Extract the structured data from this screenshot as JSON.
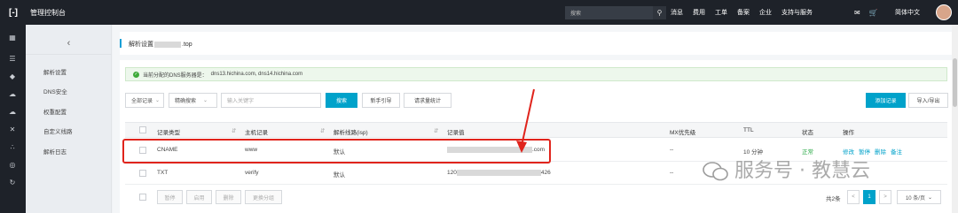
{
  "topbar": {
    "logo": "[-]",
    "title": "管理控制台",
    "search_placeholder": "搜索",
    "nav": [
      "消息",
      "费用",
      "工单",
      "备案",
      "企业",
      "支持与服务"
    ],
    "lang": "简体中文"
  },
  "subsidebar": {
    "back": "‹",
    "items": [
      "解析设置",
      "DNS安全",
      "权重配置",
      "自定义线路",
      "解析日志"
    ]
  },
  "page": {
    "title_prefix": "解析设置",
    "title_suffix": ".top"
  },
  "dns_info": {
    "label": "当前分配的DNS服务器是：",
    "servers": "dns13.hichina.com, dns14.hichina.com"
  },
  "toolbar": {
    "filter_all": "全部记录",
    "filter_mode": "精确搜索",
    "keyword_placeholder": "输入关键字",
    "search": "搜索",
    "guide": "新手引导",
    "stats": "请求量统计",
    "add": "添加记录",
    "import_export": "导入/导出"
  },
  "table": {
    "headers": [
      "记录类型",
      "主机记录",
      "解析线路(isp)",
      "记录值",
      "MX优先级",
      "TTL",
      "状态",
      "操作"
    ],
    "rows": [
      {
        "type": "CNAME",
        "host": "www",
        "line": "默认",
        "value_prefix": "",
        "value_suffix": ".com",
        "mx": "--",
        "ttl": "10 分钟",
        "status": "正常",
        "actions": [
          "修改",
          "暂停",
          "删除",
          "备注"
        ]
      },
      {
        "type": "TXT",
        "host": "verify",
        "line": "默认",
        "value_prefix": "120",
        "value_suffix": "426",
        "mx": "--",
        "ttl": "",
        "status": "",
        "actions": [
          "",
          "",
          "",
          ""
        ]
      }
    ]
  },
  "footer": {
    "buttons": [
      "暂停",
      "启用",
      "删除",
      "更换分组"
    ],
    "total": "共2条",
    "prev": "<",
    "page": "1",
    "next": ">",
    "page_size": "10 条/页"
  },
  "watermark": "服务号 · 教慧云",
  "colors": {
    "accent": "#00a2ca",
    "topbar": "#1e2229",
    "highlight": "#e0241c",
    "ok": "#27a844"
  }
}
